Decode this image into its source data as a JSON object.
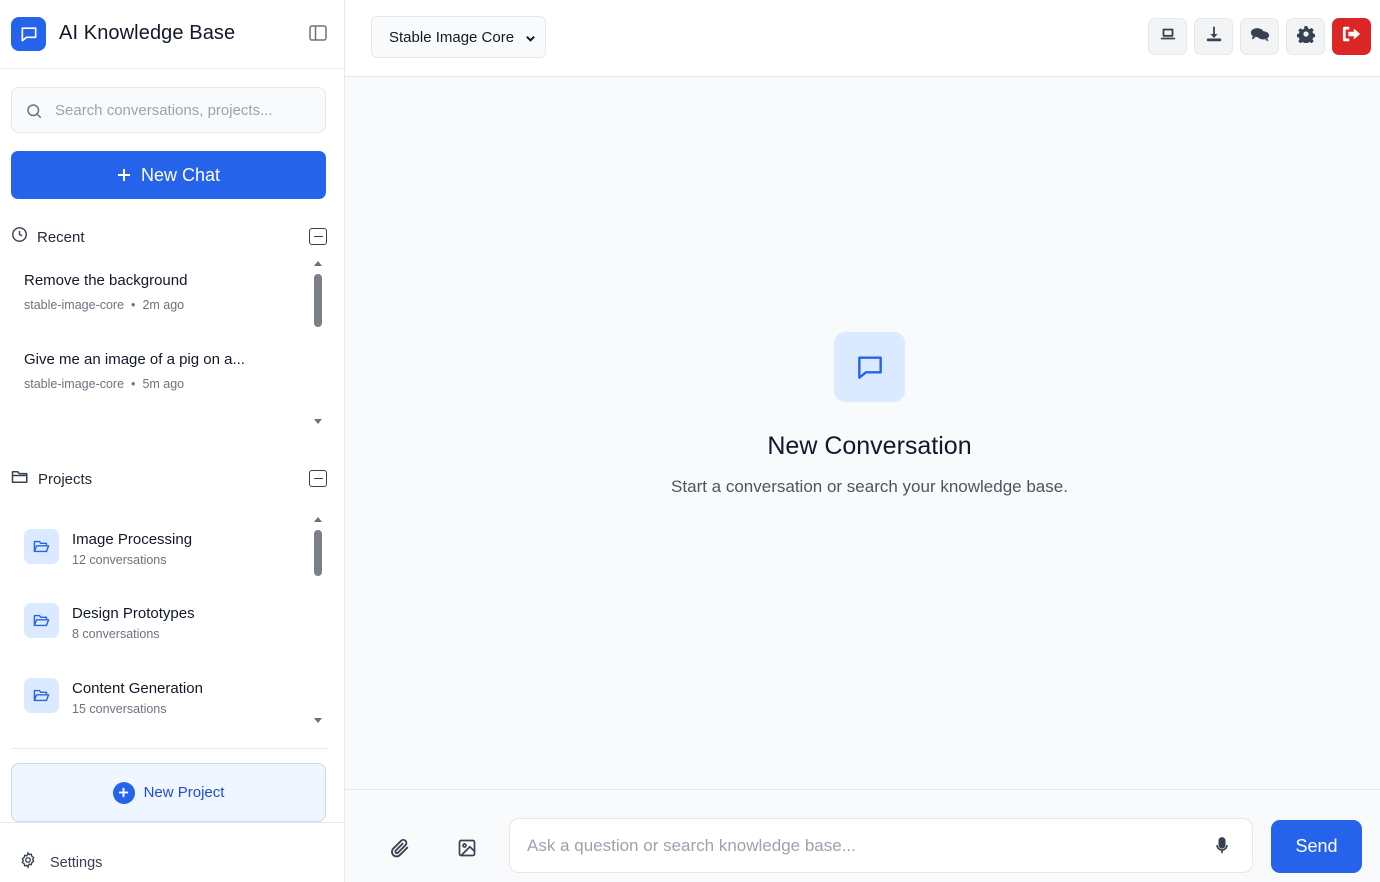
{
  "app": {
    "title": "AI Knowledge Base"
  },
  "sidebar": {
    "search_placeholder": "Search conversations, projects...",
    "new_chat_label": "New Chat",
    "recent": {
      "label": "Recent",
      "items": [
        {
          "title": "Remove the background",
          "model": "stable-image-core",
          "separator": "•",
          "time": "2m ago"
        },
        {
          "title": "Give me an image of a pig on a...",
          "model": "stable-image-core",
          "separator": "•",
          "time": "5m ago"
        }
      ]
    },
    "projects": {
      "label": "Projects",
      "items": [
        {
          "name": "Image Processing",
          "count": "12 conversations"
        },
        {
          "name": "Design Prototypes",
          "count": "8 conversations"
        },
        {
          "name": "Content Generation",
          "count": "15 conversations"
        }
      ]
    },
    "new_project_label": "New Project",
    "settings_label": "Settings"
  },
  "topbar": {
    "model_selected": "Stable Image Core",
    "buttons": [
      "laptop-icon",
      "download-icon",
      "chat-bubbles-icon",
      "gear-icon",
      "logout-icon"
    ]
  },
  "main": {
    "empty_title": "New Conversation",
    "empty_subtitle": "Start a conversation or search your knowledge base."
  },
  "composer": {
    "placeholder": "Ask a question or search knowledge base...",
    "send_label": "Send"
  },
  "colors": {
    "accent": "#2563eb",
    "accent_light": "#dbeafe",
    "danger": "#dc2626",
    "background": "#f9fafb"
  }
}
